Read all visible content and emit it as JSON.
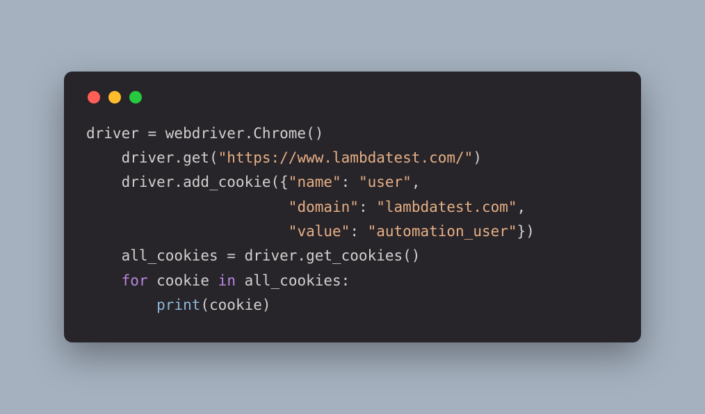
{
  "code": {
    "line1": {
      "t1": "driver = webdriver.Chrome()"
    },
    "line2": {
      "t1": "    driver.get(",
      "t2": "\"https://www.lambdatest.com/\"",
      "t3": ")"
    },
    "line3": {
      "t1": "    driver.add_cookie({",
      "t2": "\"name\"",
      "t3": ": ",
      "t4": "\"user\"",
      "t5": ","
    },
    "line4": {
      "t1": "                       ",
      "t2": "\"domain\"",
      "t3": ": ",
      "t4": "\"lambdatest.com\"",
      "t5": ","
    },
    "line5": {
      "t1": "                       ",
      "t2": "\"value\"",
      "t3": ": ",
      "t4": "\"automation_user\"",
      "t5": "})"
    },
    "line6": {
      "t1": "    all_cookies = driver.get_cookies()"
    },
    "line7": {
      "t1": "    ",
      "t2": "for",
      "t3": " cookie ",
      "t4": "in",
      "t5": " all_cookies:"
    },
    "line8": {
      "t1": "        ",
      "t2": "print",
      "t3": "(cookie)"
    }
  }
}
